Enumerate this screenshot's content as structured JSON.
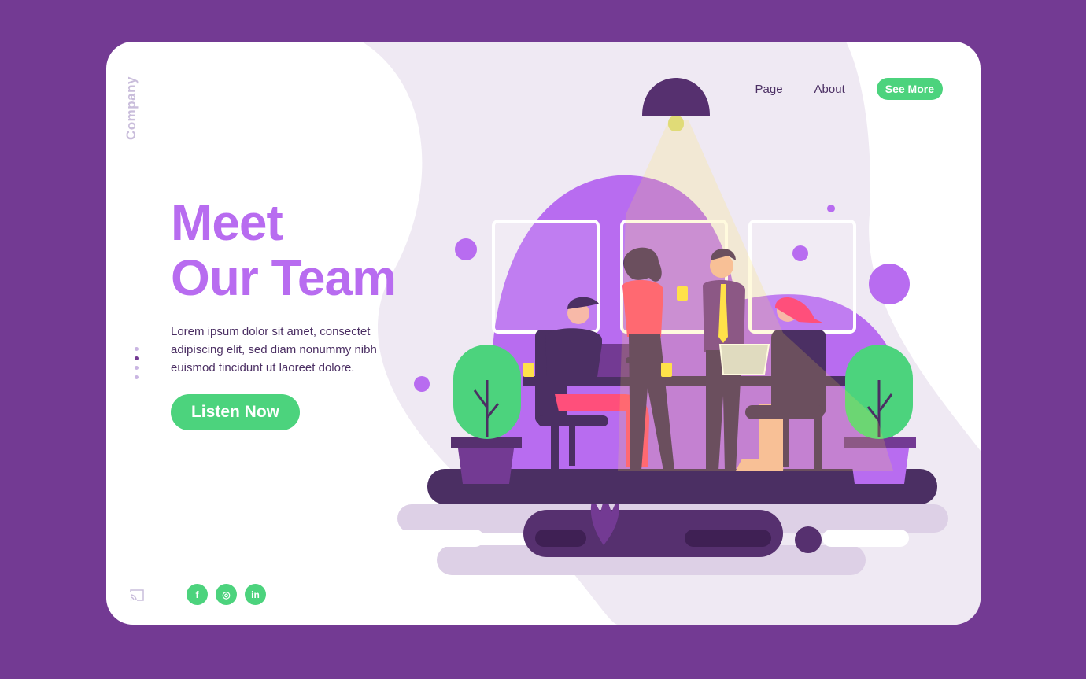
{
  "brand": {
    "name": "Company"
  },
  "nav": {
    "items": [
      "Page",
      "About"
    ],
    "cta_label": "See More"
  },
  "hero": {
    "title_line1": "Meet",
    "title_line2": "Our Team",
    "body": "Lorem ipsum dolor sit amet, consectet adipiscing elit, sed diam nonummy nibh euismod tincidunt ut laoreet dolore.",
    "button_label": "Listen Now"
  },
  "pagination": {
    "count": 4,
    "active_index": 1
  },
  "social": [
    {
      "icon": "facebook-icon",
      "glyph": "f"
    },
    {
      "icon": "instagram-icon",
      "glyph": "◎"
    },
    {
      "icon": "linkedin-icon",
      "glyph": "in"
    }
  ],
  "colors": {
    "frame": "#733a93",
    "accent_purple": "#b86cf0",
    "accent_green": "#4cd37d",
    "dark_purple": "#4b2f63",
    "soft_lilac": "#efe9f3"
  }
}
